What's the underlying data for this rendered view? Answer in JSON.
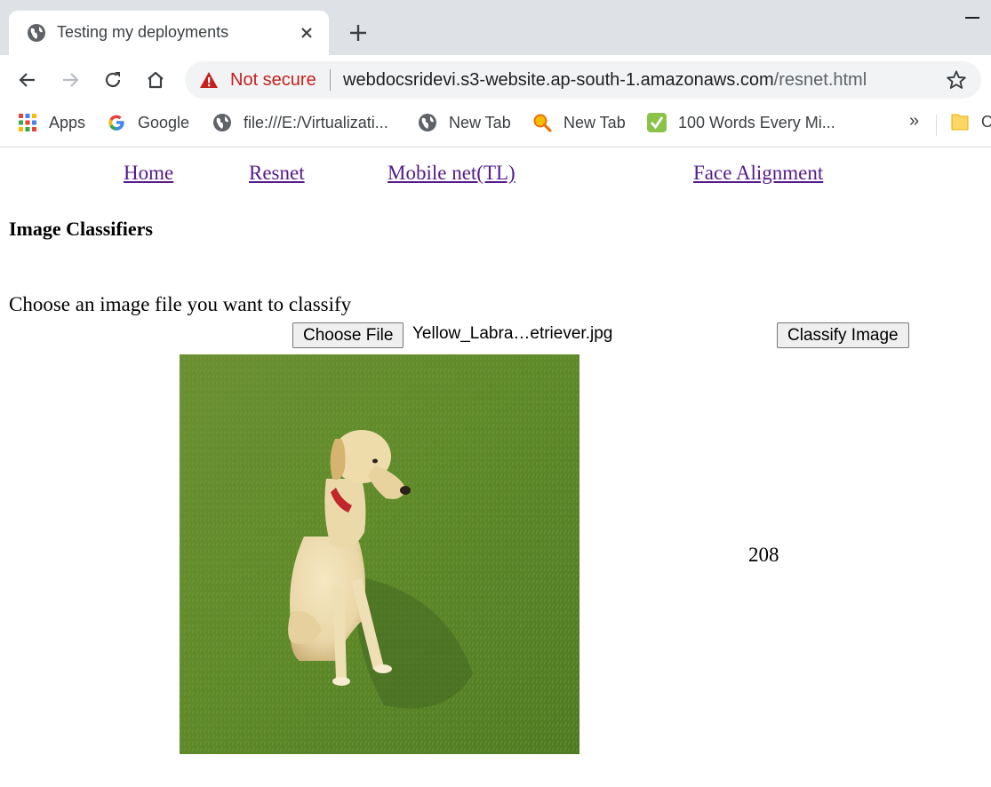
{
  "browser": {
    "tab_title": "Testing my deployments",
    "security_label": "Not secure",
    "url_domain": "webdocsridevi.s3-website.ap-south-1.amazonaws.com",
    "url_path": "/resnet.html"
  },
  "bookmarks": {
    "items": [
      {
        "label": "Apps",
        "icon": "apps-grid-icon"
      },
      {
        "label": "Google",
        "icon": "google-icon"
      },
      {
        "label": "file:///E:/Virtualizati...",
        "icon": "globe-icon"
      },
      {
        "label": "New Tab",
        "icon": "globe-icon"
      },
      {
        "label": "New Tab",
        "icon": "search-magnifier-icon"
      },
      {
        "label": "100 Words Every Mi...",
        "icon": "checkmark-icon"
      }
    ],
    "overflow": "»",
    "folder_label": "O"
  },
  "page": {
    "nav": [
      "Home",
      "Resnet",
      "Mobile net(TL)",
      "Face Alignment"
    ],
    "title": "Image Classifiers",
    "prompt": "Choose an image file you want to classify",
    "choose_file_label": "Choose File",
    "file_name": "Yellow_Labra…etriever.jpg",
    "classify_label": "Classify Image",
    "result": "208",
    "preview_subject": "yellow labrador retriever sitting on grass"
  },
  "colors": {
    "tabbar_bg": "#dee1e6",
    "omnibox_bg": "#f1f3f4",
    "warning_red": "#c5221f",
    "visited_link": "#551a8b",
    "grass_green": "#5e8a2c"
  }
}
